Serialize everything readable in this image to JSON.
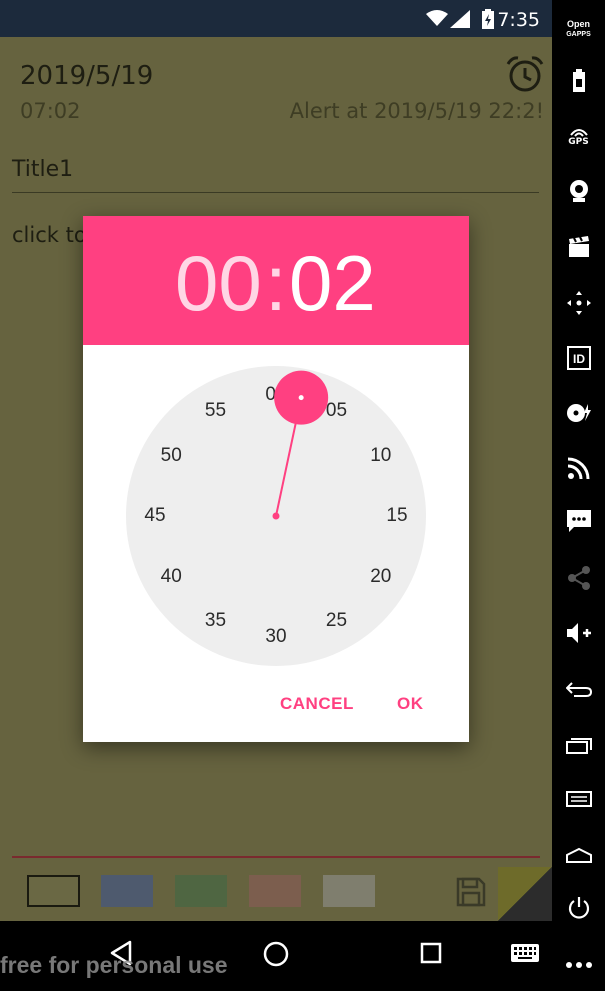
{
  "status_bar": {
    "time": "7:35"
  },
  "note": {
    "date": "2019/5/19",
    "time": "07:02",
    "alert": "Alert at 2019/5/19 22:2!",
    "title": "Title1",
    "body": "click to"
  },
  "time_picker": {
    "hour": "00",
    "colon": ":",
    "minute": "02",
    "mode": "minutes",
    "selected_minute": 2,
    "dial_labels": [
      "00",
      "05",
      "10",
      "15",
      "20",
      "25",
      "30",
      "35",
      "40",
      "45",
      "50",
      "55"
    ],
    "cancel_label": "CANCEL",
    "ok_label": "OK",
    "accent_color": "#ff4081"
  },
  "color_swatches": [
    "#6a6844",
    "#4e5a6e",
    "#4f6642",
    "#7c5e4e",
    "#7f7e6e"
  ],
  "watermark": "free for personal use",
  "side_panel": {
    "open_gapps": [
      "Open",
      "GAPPS"
    ],
    "gps_label": "GPS",
    "id_label": "ID",
    "icons": [
      "battery-icon",
      "gps-icon",
      "webcam-icon",
      "clapperboard-icon",
      "move-icon",
      "id-icon",
      "media-icon",
      "rss-icon",
      "sms-icon",
      "share-icon",
      "volume-up-icon",
      "back-icon",
      "recent-apps-icon",
      "menu-icon",
      "home-icon",
      "power-icon",
      "more-icon"
    ]
  },
  "nav_bar": {
    "icons": [
      "back-icon",
      "home-icon",
      "recents-icon",
      "keyboard-icon"
    ]
  }
}
